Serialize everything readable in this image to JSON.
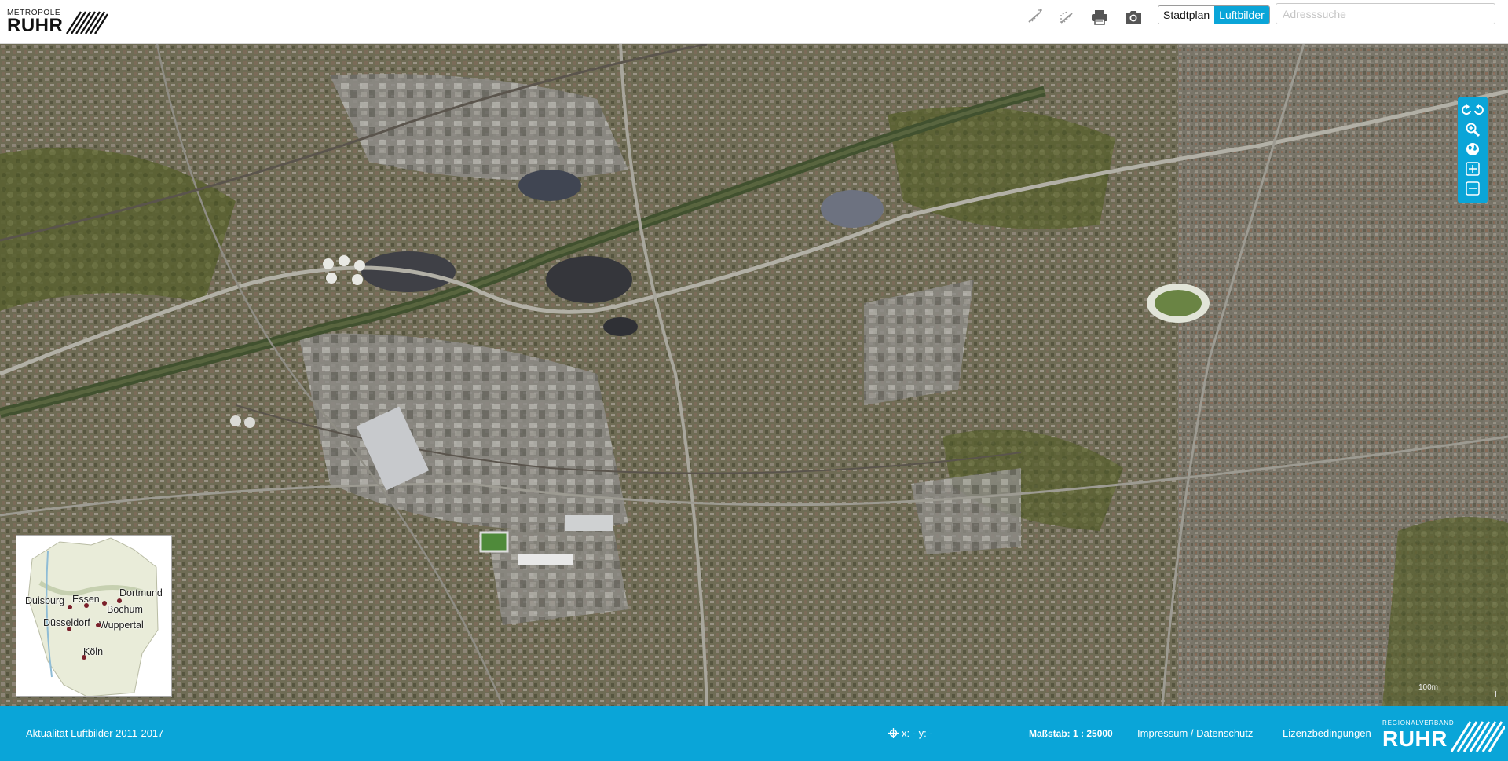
{
  "header": {
    "logo": {
      "line1": "METROPOLE",
      "line2": "RUHR"
    },
    "tools": [
      {
        "name": "measure-distance",
        "icon": "ruler-line-icon"
      },
      {
        "name": "measure-area",
        "icon": "ruler-area-icon"
      },
      {
        "name": "print",
        "icon": "printer-icon"
      },
      {
        "name": "screenshot",
        "icon": "camera-icon"
      }
    ],
    "maptype": {
      "stadtplan": "Stadtplan",
      "luftbilder": "Luftbilder",
      "active": "Luftbilder"
    },
    "search": {
      "placeholder": "Adresssuche",
      "value": ""
    }
  },
  "map_tools": [
    {
      "name": "undo-redo",
      "icon": "undo-redo-icon"
    },
    {
      "name": "zoom-box",
      "icon": "zoom-magnifier-icon"
    },
    {
      "name": "full-extent",
      "icon": "globe-icon"
    },
    {
      "name": "zoom-in",
      "icon": "plus-square-icon"
    },
    {
      "name": "zoom-out",
      "icon": "minus-square-icon"
    }
  ],
  "overview": {
    "cities": [
      "Dortmund",
      "Duisburg",
      "Essen",
      "Bochum",
      "Düsseldorf",
      "Wuppertal",
      "Köln"
    ]
  },
  "scale_label": "100m",
  "footer": {
    "aktualitaet": "Aktualität Luftbilder 2011-2017",
    "coords": "x: - y: -",
    "massstab": "Maßstab: 1 : 25000",
    "impressum": "Impressum / Datenschutz",
    "lizenz": "Lizenzbedingungen",
    "rvr": {
      "line1": "REGIONALVERBAND",
      "line2": "RUHR"
    }
  },
  "colors": {
    "accent": "#0aa5d8",
    "header_bg": "#ffffff"
  }
}
